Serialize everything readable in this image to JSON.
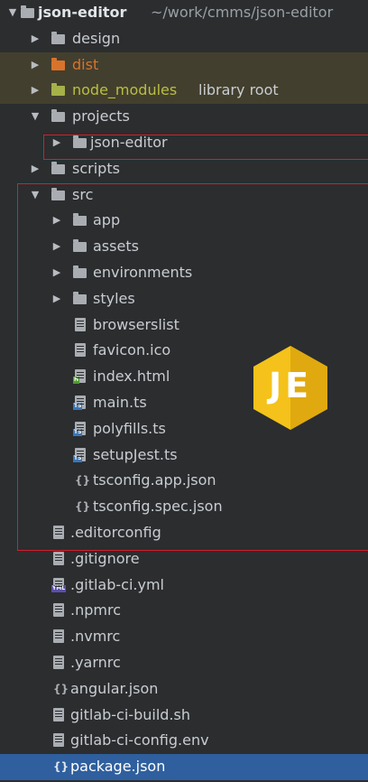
{
  "project": {
    "name": "json-editor",
    "path": "~/work/cmms/json-editor"
  },
  "folders": {
    "design": "design",
    "dist": "dist",
    "node_modules": "node_modules",
    "node_modules_tag": "library root",
    "projects": "projects",
    "projects_child": "json-editor",
    "scripts": "scripts",
    "src": "src",
    "app": "app",
    "assets": "assets",
    "environments": "environments",
    "styles": "styles"
  },
  "src_files": {
    "browserslist": "browserslist",
    "favicon": "favicon.ico",
    "index": "index.html",
    "main": "main.ts",
    "polyfills": "polyfills.ts",
    "setupJest": "setupJest.ts",
    "tsconfig_app": "tsconfig.app.json",
    "tsconfig_spec": "tsconfig.spec.json",
    "editorconfig": ".editorconfig"
  },
  "root_files": {
    "gitignore": ".gitignore",
    "gitlab_ci": ".gitlab-ci.yml",
    "npmrc": ".npmrc",
    "nvmrc": ".nvmrc",
    "yarnrc": ".yarnrc",
    "angular": "angular.json",
    "build_sh": "gitlab-ci-build.sh",
    "config_env": "gitlab-ci-config.env",
    "package": "package.json"
  },
  "logo": {
    "text": "JE"
  },
  "badges": {
    "ts": "TS",
    "html": "H",
    "yml": "YML"
  },
  "icons": {
    "expanded": "▼",
    "collapsed": "▶",
    "json": "{}"
  },
  "colors": {
    "background": "#2b2d2f",
    "excluded_row": "#433f2e",
    "selected_row": "#2f5f9e",
    "highlight_box": "#d0212c",
    "logo_yellow": "#f4c21a"
  }
}
